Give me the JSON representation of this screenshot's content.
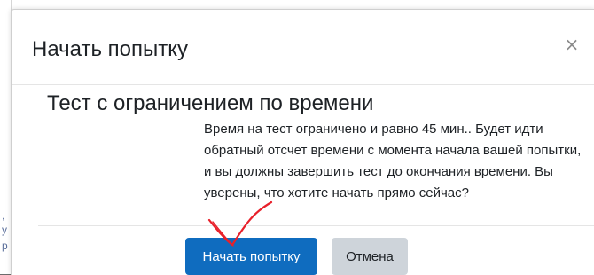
{
  "dialog": {
    "title": "Начать попытку",
    "close_symbol": "×"
  },
  "body": {
    "heading": "Тест с ограничением по времени",
    "description": "Время на тест ограничено и равно 45 мин.. Будет идти обратный отсчет времени с момента начала вашей попытки, и вы должны завершить тест до окончания времени. Вы уверены, что хотите начать прямо сейчас?"
  },
  "footer": {
    "start_label": "Начать попытку",
    "cancel_label": "Отмена"
  },
  "colors": {
    "primary": "#0f6cbf",
    "secondary": "#ced4da",
    "annotation": "#e8202a"
  },
  "annotation": {
    "icon": "hand-drawn-checkmark-icon"
  }
}
